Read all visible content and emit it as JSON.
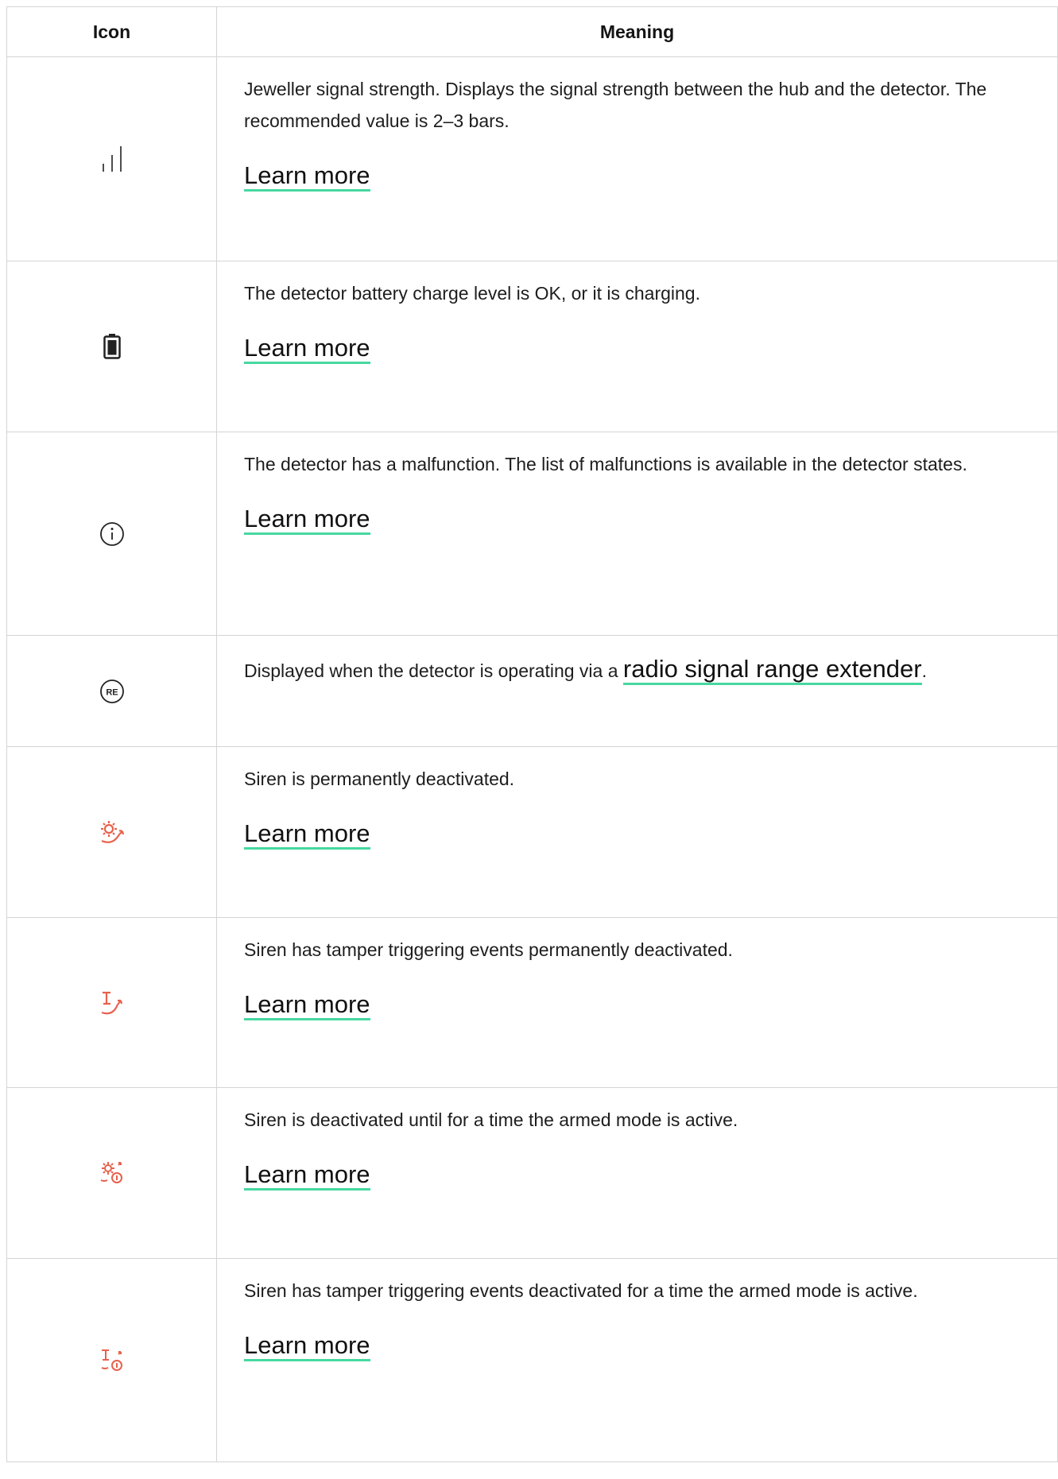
{
  "header": {
    "icon_col": "Icon",
    "meaning_col": "Meaning"
  },
  "rows": [
    {
      "icon": "signal-strength-icon",
      "text": "Jeweller signal strength. Displays the signal strength between the hub and the detector. The recommended value is 2–3 bars.",
      "link": "Learn more"
    },
    {
      "icon": "battery-icon",
      "text": "The detector battery charge level is OK, or it is charging.",
      "link": "Learn more"
    },
    {
      "icon": "info-icon",
      "text": "The detector has a malfunction. The list of malfunctions is available in the detector states.",
      "link": "Learn more"
    },
    {
      "icon": "range-extender-icon",
      "icon_label": "RE",
      "text_before": "Displayed when the detector is operating via a ",
      "link": "radio signal range extender",
      "text_after": "."
    },
    {
      "icon": "siren-off-icon",
      "text": "Siren is permanently deactivated.",
      "link": "Learn more"
    },
    {
      "icon": "tamper-siren-off-icon",
      "text": "Siren has tamper triggering events permanently deactivated.",
      "link": "Learn more"
    },
    {
      "icon": "siren-off-timed-icon",
      "text": "Siren is deactivated until for a time the armed mode is active.",
      "link": "Learn more"
    },
    {
      "icon": "tamper-siren-off-timed-icon",
      "text": "Siren has tamper triggering events deactivated for a time the armed mode is active.",
      "link": "Learn more"
    }
  ],
  "colors": {
    "link_underline": "#46d8a0",
    "alert_icon": "#e8604c",
    "border": "#d4d4d4"
  }
}
